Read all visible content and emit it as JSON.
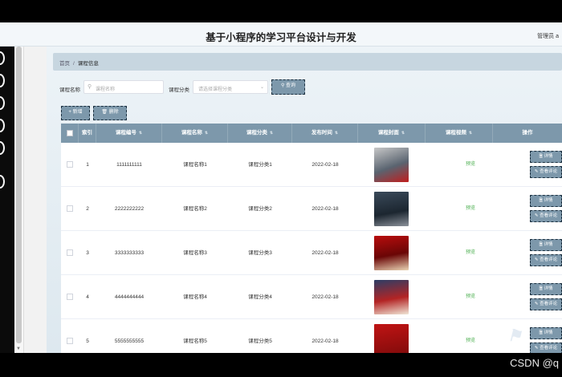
{
  "app": {
    "title": "基于小程序的学习平台设计与开发",
    "user_label": "管理员 a"
  },
  "breadcrumb": {
    "home": "首页",
    "separator": "/",
    "current": "课程信息"
  },
  "search": {
    "name_label": "课程名称",
    "name_placeholder": "课程名称",
    "category_label": "课程分类",
    "category_placeholder": "请选择课程分类",
    "search_button": "查询"
  },
  "actions": {
    "add_button": "+ 新增",
    "delete_button": "删除"
  },
  "table": {
    "headers": {
      "index": "索引",
      "code": "课程编号",
      "name": "课程名称",
      "category": "课程分类",
      "date": "发布时间",
      "cover": "课程封面",
      "video": "课程视频",
      "ops": "操作"
    },
    "rows": [
      {
        "index": "1",
        "code": "1111111111",
        "name": "课程名称1",
        "category": "课程分类1",
        "date": "2022-02-18",
        "video": "预览"
      },
      {
        "index": "2",
        "code": "2222222222",
        "name": "课程名称2",
        "category": "课程分类2",
        "date": "2022-02-18",
        "video": "预览"
      },
      {
        "index": "3",
        "code": "3333333333",
        "name": "课程名称3",
        "category": "课程分类3",
        "date": "2022-02-18",
        "video": "预览"
      },
      {
        "index": "4",
        "code": "4444444444",
        "name": "课程名称4",
        "category": "课程分类4",
        "date": "2022-02-18",
        "video": "预览"
      },
      {
        "index": "5",
        "code": "5555555555",
        "name": "课程名称5",
        "category": "课程分类5",
        "date": "2022-02-18",
        "video": "预览"
      }
    ],
    "detail_button": "详情",
    "review_button": "查看评论"
  },
  "overlay": {
    "watermark": "CSDN @q"
  }
}
